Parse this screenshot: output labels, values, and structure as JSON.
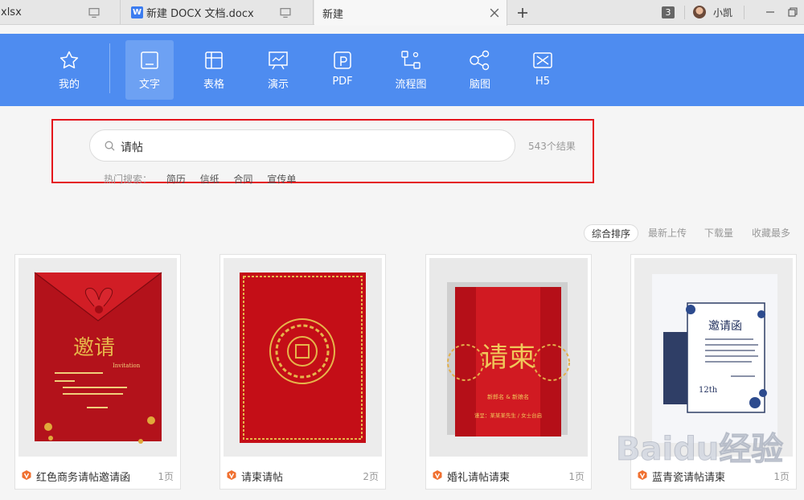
{
  "tabs": [
    {
      "label": "xlsx"
    },
    {
      "label": "新建 DOCX 文档.docx",
      "badge": "W"
    },
    {
      "label": "新建"
    }
  ],
  "tab_count": "3",
  "user": {
    "name": "小凯"
  },
  "categories": [
    {
      "label": "我的",
      "icon": "star-icon"
    },
    {
      "label": "文字",
      "icon": "document-icon"
    },
    {
      "label": "表格",
      "icon": "table-icon"
    },
    {
      "label": "演示",
      "icon": "presentation-icon"
    },
    {
      "label": "PDF",
      "icon": "pdf-icon"
    },
    {
      "label": "流程图",
      "icon": "flowchart-icon"
    },
    {
      "label": "脑图",
      "icon": "mindmap-icon"
    },
    {
      "label": "H5",
      "icon": "h5-icon"
    }
  ],
  "search": {
    "value": "请帖",
    "result_count": "543个结果"
  },
  "hot_search": {
    "label": "热门搜索：",
    "items": [
      "简历",
      "信纸",
      "合同",
      "宣传单"
    ]
  },
  "sort": [
    "综合排序",
    "最新上传",
    "下载量",
    "收藏最多"
  ],
  "cards": [
    {
      "title": "红色商务请帖邀请函",
      "pages": "1页",
      "thumb_text": "邀请",
      "thumb_sub": "Invitation"
    },
    {
      "title": "请柬请帖",
      "pages": "2页"
    },
    {
      "title": "婚礼请帖请柬",
      "pages": "1页",
      "thumb_text": "请柬",
      "thumb_names": "新郎名 & 新娘名",
      "thumb_date": "谨呈：某某某先生 / 女士台启"
    },
    {
      "title": "蓝青瓷请帖请柬",
      "pages": "1页",
      "thumb_text": "邀请函",
      "thumb_date": "12th"
    }
  ],
  "watermark": "Baidu经验",
  "colors": {
    "accent": "#4e8cf0",
    "highlight": "#e4131b",
    "doc_icon": "#f07030"
  }
}
